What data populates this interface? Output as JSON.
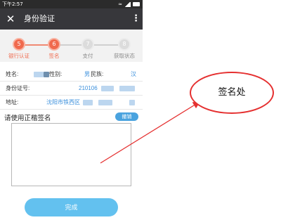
{
  "status_bar": {
    "time": "下午2:57",
    "wifi_glyph": "≈"
  },
  "title_bar": {
    "close_glyph": "✕",
    "title": "身份验证",
    "more_glyph": "⋮"
  },
  "steps": [
    {
      "number": "5",
      "label": "银行认证",
      "state": "active"
    },
    {
      "number": "6",
      "label": "签名",
      "state": "active"
    },
    {
      "number": "7",
      "label": "支付",
      "state": "inactive"
    },
    {
      "number": "8",
      "label": "获取状态",
      "state": "inactive"
    }
  ],
  "identity": {
    "name_label": "姓名:",
    "gender_label": "性别:",
    "gender_value": "男",
    "ethnicity_label": "民族:",
    "ethnicity_value": "汉",
    "id_label": "身份证号:",
    "id_value_visible": "210106",
    "address_label": "地址:",
    "address_value_visible": "沈阳市铁西区"
  },
  "signature": {
    "prompt": "请使用正楷签名",
    "clear_label": "撤销"
  },
  "done_label": "完成",
  "annotation": {
    "text": "签名处"
  },
  "colors": {
    "accent": "#f06a4e",
    "link_blue": "#3a8fdc",
    "button_blue": "#63c1ef",
    "titlebar": "#37373b",
    "annotation_red": "#e53030"
  }
}
